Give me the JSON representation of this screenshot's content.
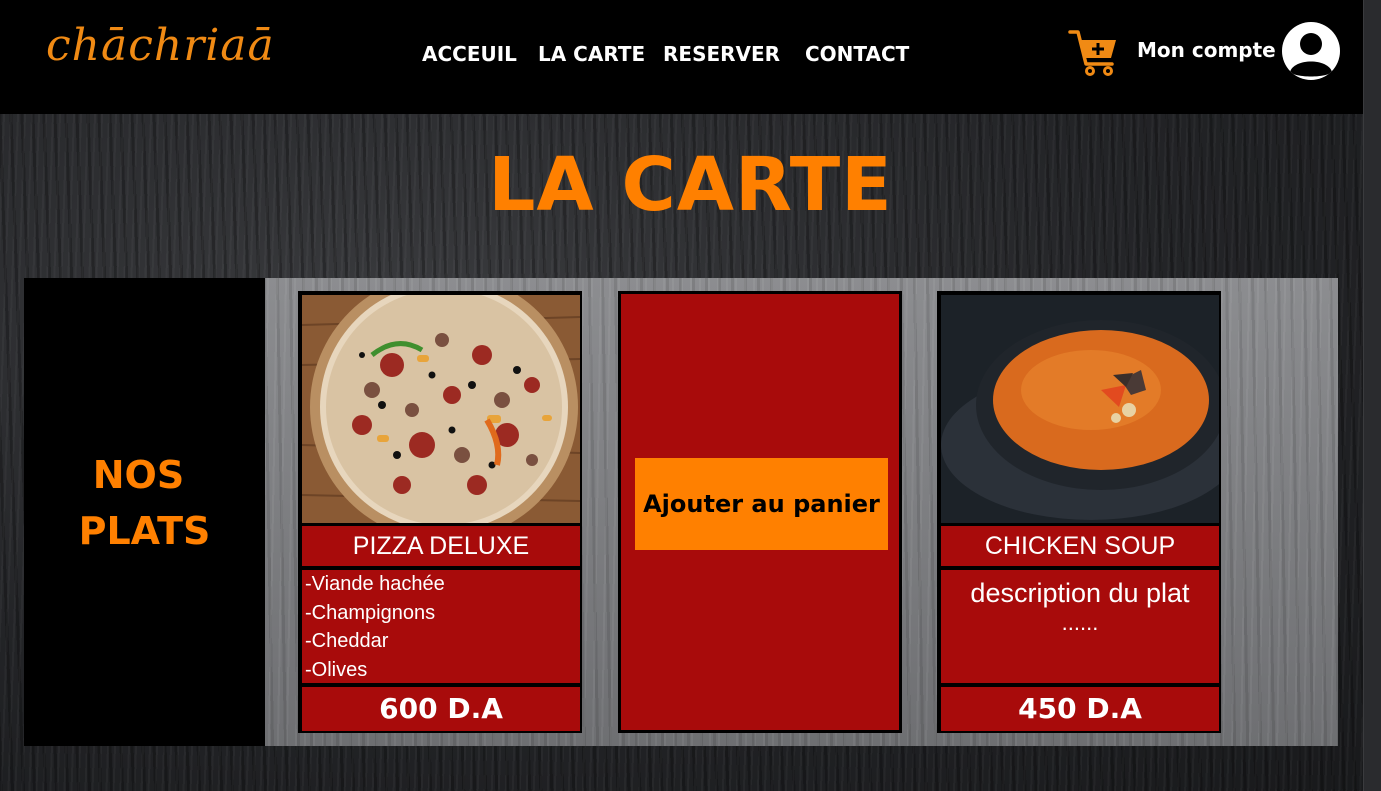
{
  "header": {
    "logo_text": "chāchriaā",
    "nav": [
      {
        "label": "ACCEUIL"
      },
      {
        "label": "LA CARTE"
      },
      {
        "label": "RESERVER"
      },
      {
        "label": "CONTACT"
      }
    ],
    "account_label": "Mon compte",
    "cart_icon": "cart-add-icon",
    "avatar_icon": "user-avatar-icon"
  },
  "main": {
    "title": "LA CARTE",
    "section_label_line1": "NOS",
    "section_label_line2": "PLATS",
    "add_to_cart_label": "Ajouter au panier",
    "dishes": [
      {
        "name": "PIZZA DELUXE",
        "ingredients": [
          "-Viande hachée",
          "-Champignons",
          "-Cheddar",
          "-Olives"
        ],
        "price": "600 D.A",
        "image": "pizza-photo"
      },
      {
        "name": "CHICKEN SOUP",
        "description": "description du plat",
        "description_more": "......",
        "price": "450 D.A",
        "image": "soup-photo"
      }
    ]
  },
  "colors": {
    "accent": "#ff8000",
    "card_red": "#a80b0b",
    "navbar_bg": "#000000"
  }
}
